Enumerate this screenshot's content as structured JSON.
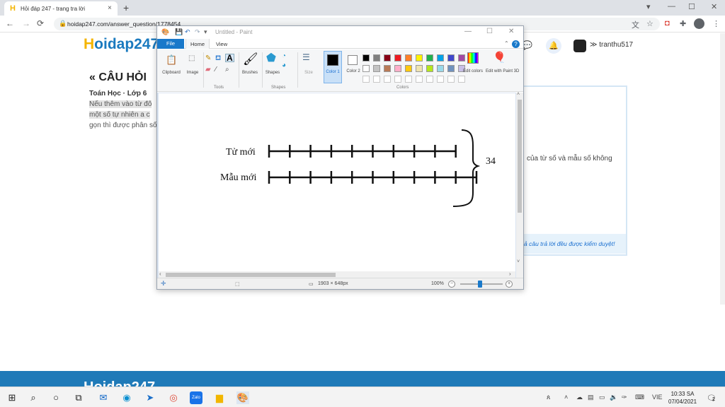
{
  "browser": {
    "tab_title": "Hỏi đáp 247 - trang tra lời",
    "tab_close": "×",
    "new_tab": "+",
    "url": "hoidap247.com/answer_question/1778454",
    "nav": {
      "back": "←",
      "forward": "→",
      "reload": "⟳"
    },
    "window": {
      "minimize": "—",
      "maximize": "☐",
      "close": "✕",
      "tab_search": "▾"
    }
  },
  "site": {
    "logo_h": "H",
    "logo_rest": "oidap247",
    "username": "tranthu517",
    "section_title": "« CÂU HỎI",
    "subject": "Toán Học · Lớp 6",
    "question_lines": [
      "Nếu thêm vào từ đô",
      "một số tự nhiên a c",
      "gọn thì được phân số"
    ],
    "card_text": "của từ số và mẫu số không",
    "verified_note": "ả câu trả lời đều được kiểm duyệt!",
    "footer_logo": "Hoidap247"
  },
  "paint": {
    "window_title": "Untitled - Paint",
    "menu": {
      "file": "File",
      "home": "Home",
      "view": "View"
    },
    "ribbon": {
      "clipboard": "Clipboard",
      "image": "Image",
      "tools_group": "Tools",
      "brushes": "Brushes",
      "shapes": "Shapes",
      "shapes_group": "Shapes",
      "size": "Size",
      "color1": "Color 1",
      "color2": "Color 2",
      "edit_colors": "Edit colors",
      "edit_paint3d": "Edit with Paint 3D",
      "colors_group": "Colors"
    },
    "palette": [
      "#000000",
      "#7f7f7f",
      "#880015",
      "#ed1c24",
      "#ff7f27",
      "#fff200",
      "#22b14c",
      "#00a2e8",
      "#3f48cc",
      "#a349a4",
      "#ffffff",
      "#c3c3c3",
      "#b97a57",
      "#ffaec9",
      "#ffc90e",
      "#efe4b0",
      "#b5e61d",
      "#99d9ea",
      "#7092be",
      "#c8bfe7"
    ],
    "color1_value": "#000000",
    "color2_value": "#ffffff",
    "canvas_drawing": {
      "label_top": "Tử mới",
      "label_bottom": "Mẫu mới",
      "top_segments": 9,
      "bottom_segments": 10,
      "brace_value": "34"
    },
    "status": {
      "canvas_size": "1903 × 648px",
      "zoom": "100%",
      "zoom_minus": "−",
      "zoom_plus": "+"
    }
  },
  "taskbar": {
    "time": "10:33 SA",
    "date": "07/04/2021",
    "language": "VIE",
    "notification_count": "2"
  }
}
